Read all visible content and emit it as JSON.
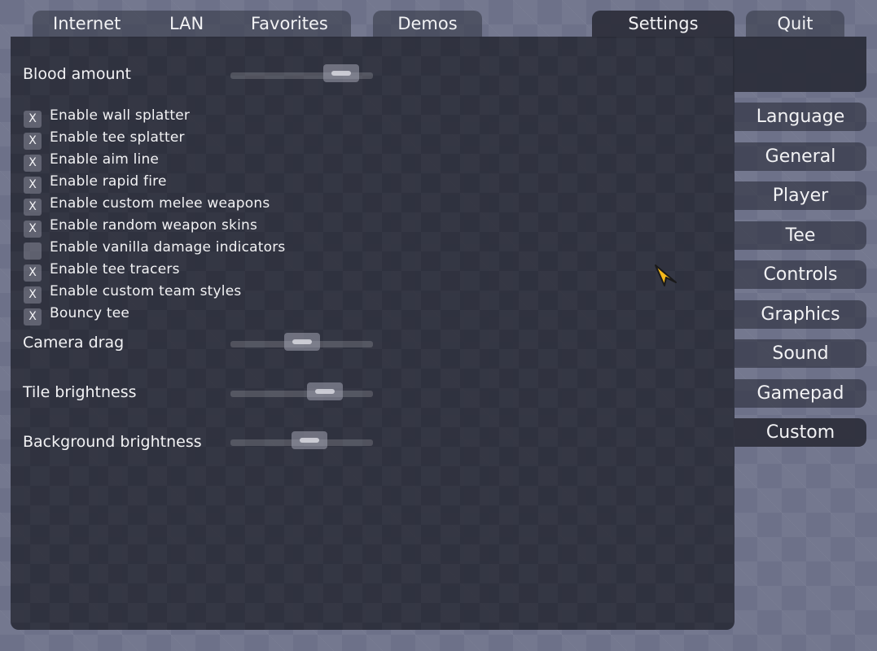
{
  "tabs": {
    "internet": "Internet",
    "lan": "LAN",
    "favorites": "Favorites",
    "demos": "Demos",
    "settings": "Settings",
    "quit": "Quit"
  },
  "settings": {
    "blood_amount": {
      "label": "Blood amount",
      "value": 0.87
    },
    "checkboxes": [
      {
        "label": "Enable wall splatter",
        "checked": true,
        "mark": "X"
      },
      {
        "label": "Enable tee splatter",
        "checked": true,
        "mark": "X"
      },
      {
        "label": "Enable aim line",
        "checked": true,
        "mark": "X"
      },
      {
        "label": "Enable rapid fire",
        "checked": true,
        "mark": "X"
      },
      {
        "label": "Enable custom melee weapons",
        "checked": true,
        "mark": "X"
      },
      {
        "label": "Enable random weapon skins",
        "checked": true,
        "mark": "X"
      },
      {
        "label": "Enable vanilla damage indicators",
        "checked": false,
        "mark": ""
      },
      {
        "label": "Enable tee tracers",
        "checked": true,
        "mark": "X"
      },
      {
        "label": "Enable custom team styles",
        "checked": true,
        "mark": "X"
      },
      {
        "label": "Bouncy tee",
        "checked": true,
        "mark": "X"
      }
    ],
    "camera_drag": {
      "label": "Camera drag",
      "value": 0.5
    },
    "tile_brightness": {
      "label": "Tile brightness",
      "value": 0.72
    },
    "background_brightness": {
      "label": "Background brightness",
      "value": 0.57
    }
  },
  "sidebar": [
    "Language",
    "General",
    "Player",
    "Tee",
    "Controls",
    "Graphics",
    "Sound",
    "Gamepad",
    "Custom"
  ],
  "sidebar_active": "Custom",
  "colors": {
    "background": "#6d7189",
    "panel": "#2a2c38",
    "cursor": "#f5b819"
  }
}
